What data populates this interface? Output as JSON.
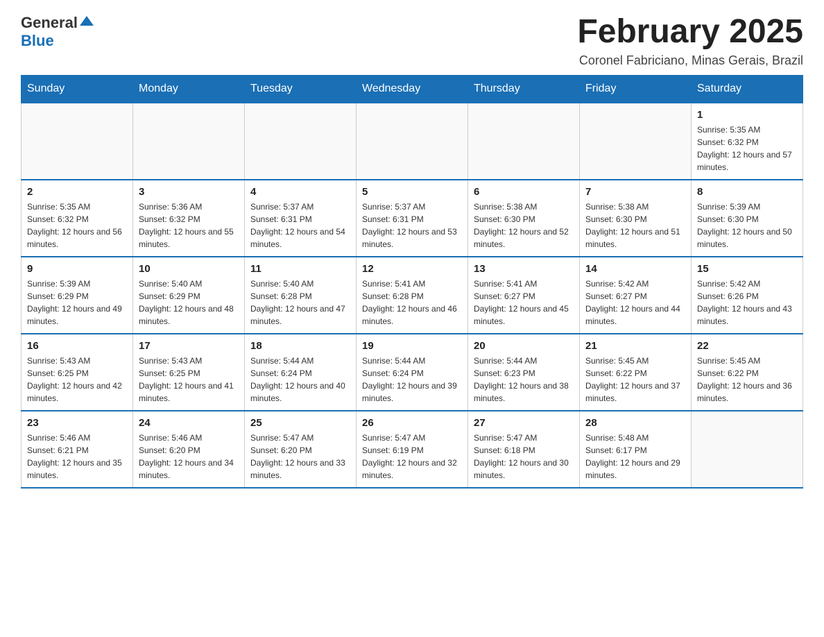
{
  "header": {
    "logo_general": "General",
    "logo_blue": "Blue",
    "month_title": "February 2025",
    "location": "Coronel Fabriciano, Minas Gerais, Brazil"
  },
  "days_of_week": [
    "Sunday",
    "Monday",
    "Tuesday",
    "Wednesday",
    "Thursday",
    "Friday",
    "Saturday"
  ],
  "weeks": [
    {
      "days": [
        {
          "date": "",
          "info": ""
        },
        {
          "date": "",
          "info": ""
        },
        {
          "date": "",
          "info": ""
        },
        {
          "date": "",
          "info": ""
        },
        {
          "date": "",
          "info": ""
        },
        {
          "date": "",
          "info": ""
        },
        {
          "date": "1",
          "info": "Sunrise: 5:35 AM\nSunset: 6:32 PM\nDaylight: 12 hours and 57 minutes."
        }
      ]
    },
    {
      "days": [
        {
          "date": "2",
          "info": "Sunrise: 5:35 AM\nSunset: 6:32 PM\nDaylight: 12 hours and 56 minutes."
        },
        {
          "date": "3",
          "info": "Sunrise: 5:36 AM\nSunset: 6:32 PM\nDaylight: 12 hours and 55 minutes."
        },
        {
          "date": "4",
          "info": "Sunrise: 5:37 AM\nSunset: 6:31 PM\nDaylight: 12 hours and 54 minutes."
        },
        {
          "date": "5",
          "info": "Sunrise: 5:37 AM\nSunset: 6:31 PM\nDaylight: 12 hours and 53 minutes."
        },
        {
          "date": "6",
          "info": "Sunrise: 5:38 AM\nSunset: 6:30 PM\nDaylight: 12 hours and 52 minutes."
        },
        {
          "date": "7",
          "info": "Sunrise: 5:38 AM\nSunset: 6:30 PM\nDaylight: 12 hours and 51 minutes."
        },
        {
          "date": "8",
          "info": "Sunrise: 5:39 AM\nSunset: 6:30 PM\nDaylight: 12 hours and 50 minutes."
        }
      ]
    },
    {
      "days": [
        {
          "date": "9",
          "info": "Sunrise: 5:39 AM\nSunset: 6:29 PM\nDaylight: 12 hours and 49 minutes."
        },
        {
          "date": "10",
          "info": "Sunrise: 5:40 AM\nSunset: 6:29 PM\nDaylight: 12 hours and 48 minutes."
        },
        {
          "date": "11",
          "info": "Sunrise: 5:40 AM\nSunset: 6:28 PM\nDaylight: 12 hours and 47 minutes."
        },
        {
          "date": "12",
          "info": "Sunrise: 5:41 AM\nSunset: 6:28 PM\nDaylight: 12 hours and 46 minutes."
        },
        {
          "date": "13",
          "info": "Sunrise: 5:41 AM\nSunset: 6:27 PM\nDaylight: 12 hours and 45 minutes."
        },
        {
          "date": "14",
          "info": "Sunrise: 5:42 AM\nSunset: 6:27 PM\nDaylight: 12 hours and 44 minutes."
        },
        {
          "date": "15",
          "info": "Sunrise: 5:42 AM\nSunset: 6:26 PM\nDaylight: 12 hours and 43 minutes."
        }
      ]
    },
    {
      "days": [
        {
          "date": "16",
          "info": "Sunrise: 5:43 AM\nSunset: 6:25 PM\nDaylight: 12 hours and 42 minutes."
        },
        {
          "date": "17",
          "info": "Sunrise: 5:43 AM\nSunset: 6:25 PM\nDaylight: 12 hours and 41 minutes."
        },
        {
          "date": "18",
          "info": "Sunrise: 5:44 AM\nSunset: 6:24 PM\nDaylight: 12 hours and 40 minutes."
        },
        {
          "date": "19",
          "info": "Sunrise: 5:44 AM\nSunset: 6:24 PM\nDaylight: 12 hours and 39 minutes."
        },
        {
          "date": "20",
          "info": "Sunrise: 5:44 AM\nSunset: 6:23 PM\nDaylight: 12 hours and 38 minutes."
        },
        {
          "date": "21",
          "info": "Sunrise: 5:45 AM\nSunset: 6:22 PM\nDaylight: 12 hours and 37 minutes."
        },
        {
          "date": "22",
          "info": "Sunrise: 5:45 AM\nSunset: 6:22 PM\nDaylight: 12 hours and 36 minutes."
        }
      ]
    },
    {
      "days": [
        {
          "date": "23",
          "info": "Sunrise: 5:46 AM\nSunset: 6:21 PM\nDaylight: 12 hours and 35 minutes."
        },
        {
          "date": "24",
          "info": "Sunrise: 5:46 AM\nSunset: 6:20 PM\nDaylight: 12 hours and 34 minutes."
        },
        {
          "date": "25",
          "info": "Sunrise: 5:47 AM\nSunset: 6:20 PM\nDaylight: 12 hours and 33 minutes."
        },
        {
          "date": "26",
          "info": "Sunrise: 5:47 AM\nSunset: 6:19 PM\nDaylight: 12 hours and 32 minutes."
        },
        {
          "date": "27",
          "info": "Sunrise: 5:47 AM\nSunset: 6:18 PM\nDaylight: 12 hours and 30 minutes."
        },
        {
          "date": "28",
          "info": "Sunrise: 5:48 AM\nSunset: 6:17 PM\nDaylight: 12 hours and 29 minutes."
        },
        {
          "date": "",
          "info": ""
        }
      ]
    }
  ]
}
